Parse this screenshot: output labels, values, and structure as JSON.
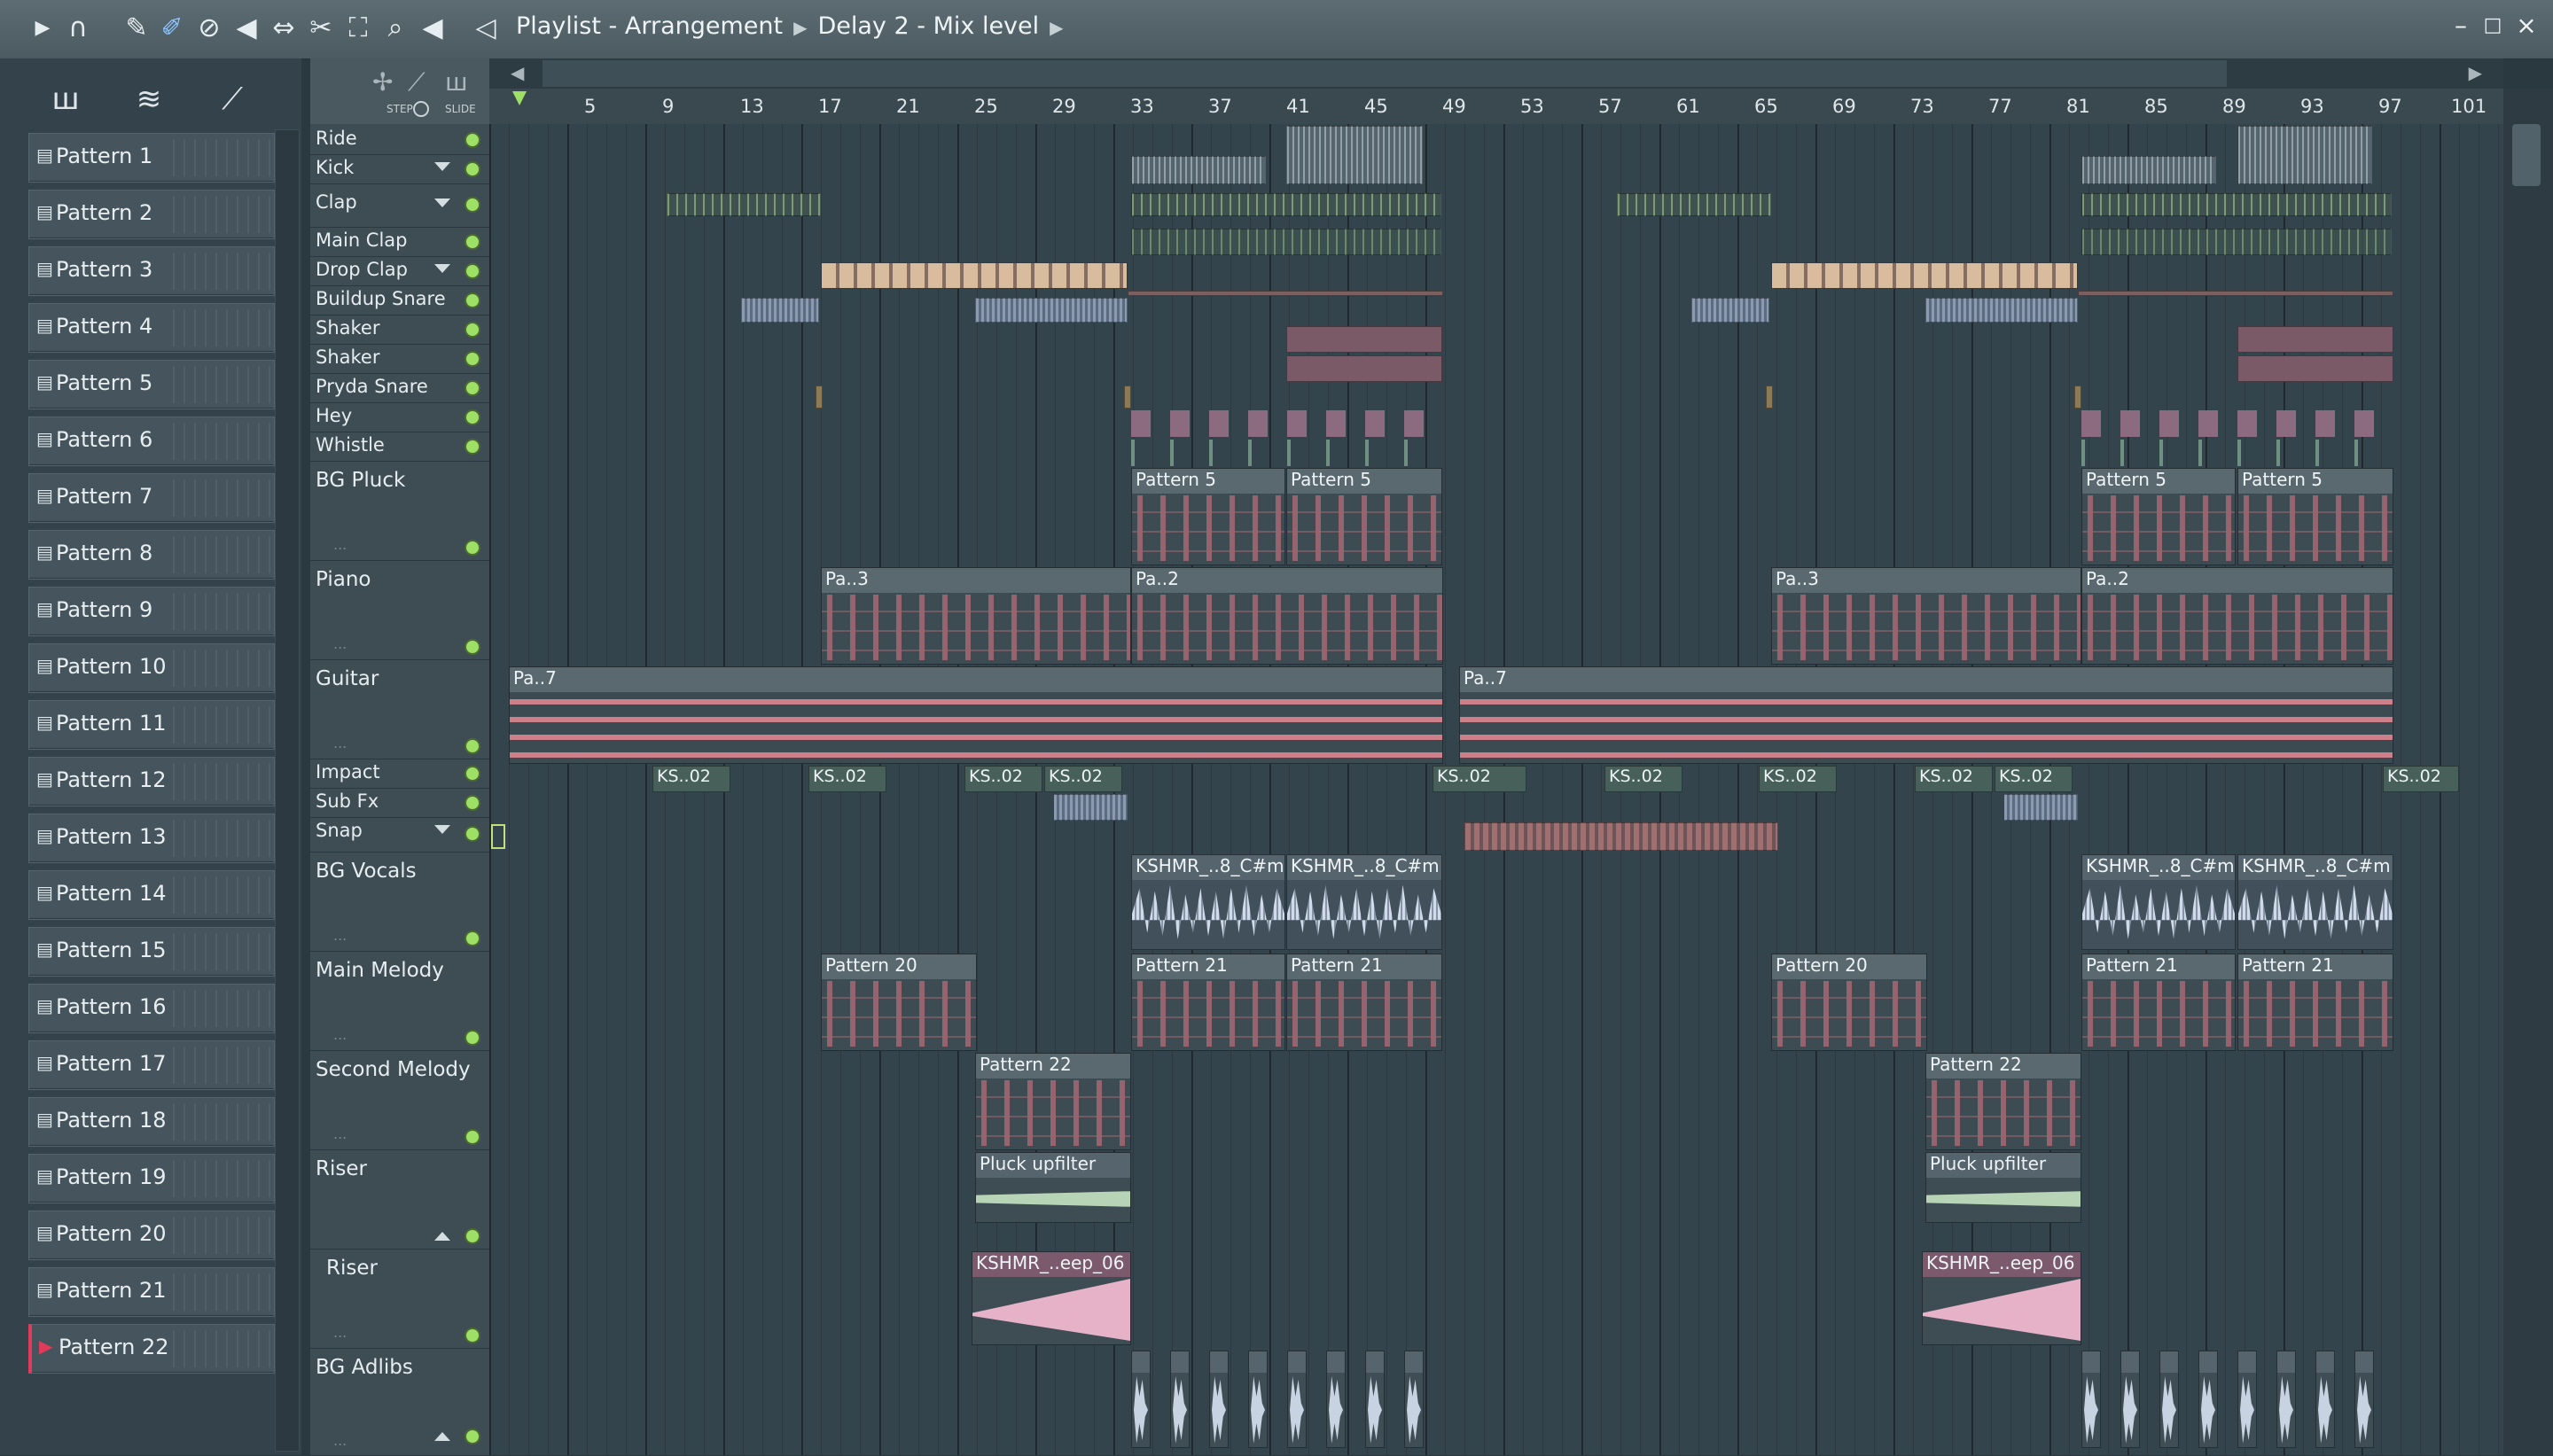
{
  "toolbar": {
    "title": "Playlist - Arrangement",
    "breadcrumb": [
      "Delay 2 - Mix level"
    ],
    "icons": [
      "play-arrow-icon",
      "magnet-icon",
      "pencil-icon",
      "paint-brush-icon",
      "delete-icon",
      "mute-icon",
      "slip-icon",
      "slice-icon",
      "select-icon",
      "zoom-icon",
      "playback-icon",
      "speaker-icon"
    ]
  },
  "window_controls": [
    "–",
    "□",
    "×"
  ],
  "header_tools": {
    "step_label": "STEP",
    "slide_label": "SLIDE"
  },
  "patterns": [
    "Pattern 1",
    "Pattern 2",
    "Pattern 3",
    "Pattern 4",
    "Pattern 5",
    "Pattern 6",
    "Pattern 7",
    "Pattern 8",
    "Pattern 9",
    "Pattern 10",
    "Pattern 11",
    "Pattern 12",
    "Pattern 13",
    "Pattern 14",
    "Pattern 15",
    "Pattern 16",
    "Pattern 17",
    "Pattern 18",
    "Pattern 19",
    "Pattern 20",
    "Pattern 21",
    "Pattern 22"
  ],
  "selected_pattern": "Pattern 22",
  "ruler": [
    "5",
    "9",
    "13",
    "17",
    "21",
    "25",
    "29",
    "33",
    "37",
    "41",
    "45",
    "49",
    "53",
    "57",
    "61",
    "65",
    "69",
    "73",
    "77",
    "81",
    "85",
    "89",
    "93",
    "97",
    "101"
  ],
  "tracks": [
    "Ride",
    "Kick",
    "Clap",
    "Main Clap",
    "Drop Clap",
    "Buildup Snare",
    "Shaker",
    "Shaker",
    "Pryda Snare",
    "Hey",
    "Whistle",
    "BG Pluck",
    "Piano",
    "Guitar",
    "Impact",
    "Sub Fx",
    "Snap",
    "BG Vocals",
    "Main Melody",
    "Second Melody",
    "Riser",
    "Riser",
    "BG Adlibs"
  ],
  "clips": {
    "pattern5": "Pattern 5",
    "pa3": "Pa..3",
    "pa2": "Pa..2",
    "pa7": "Pa..7",
    "ks02": "KS..02",
    "bgvox": "KSHMR_..8_C#m",
    "pattern20": "Pattern 20",
    "pattern21": "Pattern 21",
    "pattern22": "Pattern 22",
    "pluck": "Pluck upfilter",
    "kshmr_eep": "KSHMR_..eep_06"
  }
}
